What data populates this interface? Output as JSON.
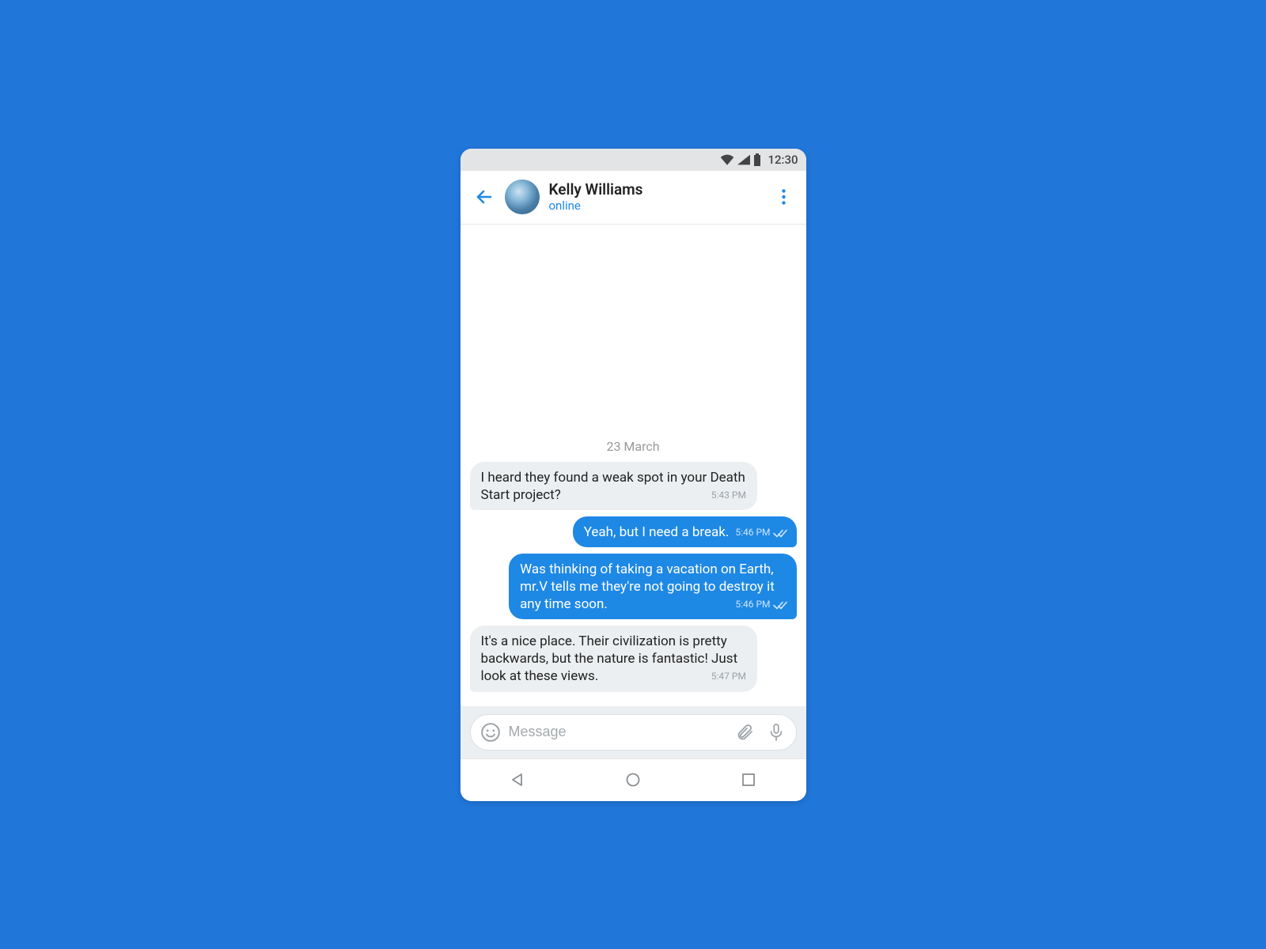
{
  "status_bar": {
    "time": "12:30"
  },
  "header": {
    "contact_name": "Kelly Williams",
    "contact_status": "online"
  },
  "chat": {
    "date_label": "23 March",
    "messages": [
      {
        "direction": "in",
        "text": "I heard they found a weak spot in your Death Start project?",
        "time": "5:43 PM",
        "read": false
      },
      {
        "direction": "out",
        "text": "Yeah, but I need a break.",
        "time": "5:46 PM",
        "read": true
      },
      {
        "direction": "out",
        "text": "Was thinking of taking a vacation on Earth, mr.V tells me they're not going to destroy it any time soon.",
        "time": "5:46 PM",
        "read": true
      },
      {
        "direction": "in",
        "text": "It's a nice place. Their civilization is pretty backwards, but the nature is fantastic! Just look at these views.",
        "time": "5:47 PM",
        "read": false
      }
    ]
  },
  "composer": {
    "placeholder": "Message"
  },
  "colors": {
    "page_bg": "#2176d9",
    "accent": "#1e88e5",
    "bubble_in": "#eceff1",
    "bubble_out": "#1e88e5"
  }
}
